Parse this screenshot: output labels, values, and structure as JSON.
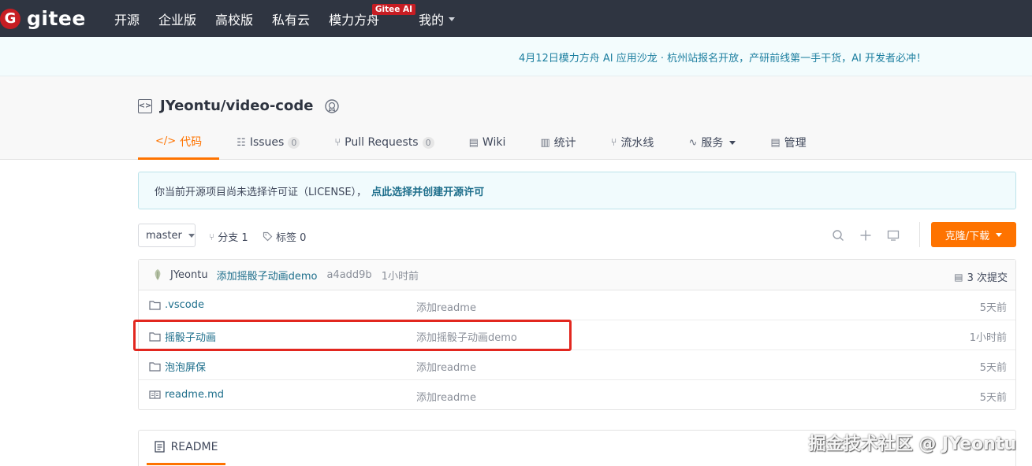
{
  "brand": {
    "badge": "G",
    "name": "gitee"
  },
  "nav": {
    "items": [
      "开源",
      "企业版",
      "高校版",
      "私有云",
      "模力方舟",
      "我的"
    ],
    "ai_badge": "Gitee AI"
  },
  "announcement": "4月12日模力方舟 AI 应用沙龙 · 杭州站报名开放，产研前线第一手干货，AI 开发者必冲！",
  "repo": {
    "full_name": "JYeontu/video-code"
  },
  "tabs": [
    {
      "label": "代码",
      "icon": "</>"
    },
    {
      "label": "Issues",
      "count": "0",
      "icon": "☷"
    },
    {
      "label": "Pull Requests",
      "count": "0",
      "icon": "⑂"
    },
    {
      "label": "Wiki",
      "icon": "▤"
    },
    {
      "label": "统计",
      "icon": "▥"
    },
    {
      "label": "流水线",
      "icon": "⑂"
    },
    {
      "label": "服务",
      "icon": "∿"
    },
    {
      "label": "管理",
      "icon": "▤"
    }
  ],
  "notice": {
    "text": "你当前开源项目尚未选择许可证（LICENSE），",
    "link": "点此选择并创建开源许可"
  },
  "toolbar": {
    "branch": "master",
    "branches_label": "分支 1",
    "tags_label": "标签 0",
    "clone_label": "克隆/下载"
  },
  "commit": {
    "author": "JYeontu",
    "message": "添加摇骰子动画demo",
    "hash": "a4add9b",
    "time": "1小时前",
    "count_label": "3 次提交"
  },
  "files": [
    {
      "name": ".vscode",
      "type": "folder",
      "message": "添加readme",
      "time": "5天前"
    },
    {
      "name": "摇骰子动画",
      "type": "folder",
      "message": "添加摇骰子动画demo",
      "time": "1小时前"
    },
    {
      "name": "泡泡屏保",
      "type": "folder",
      "message": "添加readme",
      "time": "5天前"
    },
    {
      "name": "readme.md",
      "type": "file",
      "message": "添加readme",
      "time": "5天前"
    }
  ],
  "readme": {
    "tab_label": "README"
  },
  "watermark": "掘金技术社区 @ JYeontu",
  "colors": {
    "accent": "#fe7300",
    "nav_bg": "#2f3541",
    "brand_red": "#c71d23",
    "link": "#1d6e8b",
    "highlight": "#e2271f"
  }
}
